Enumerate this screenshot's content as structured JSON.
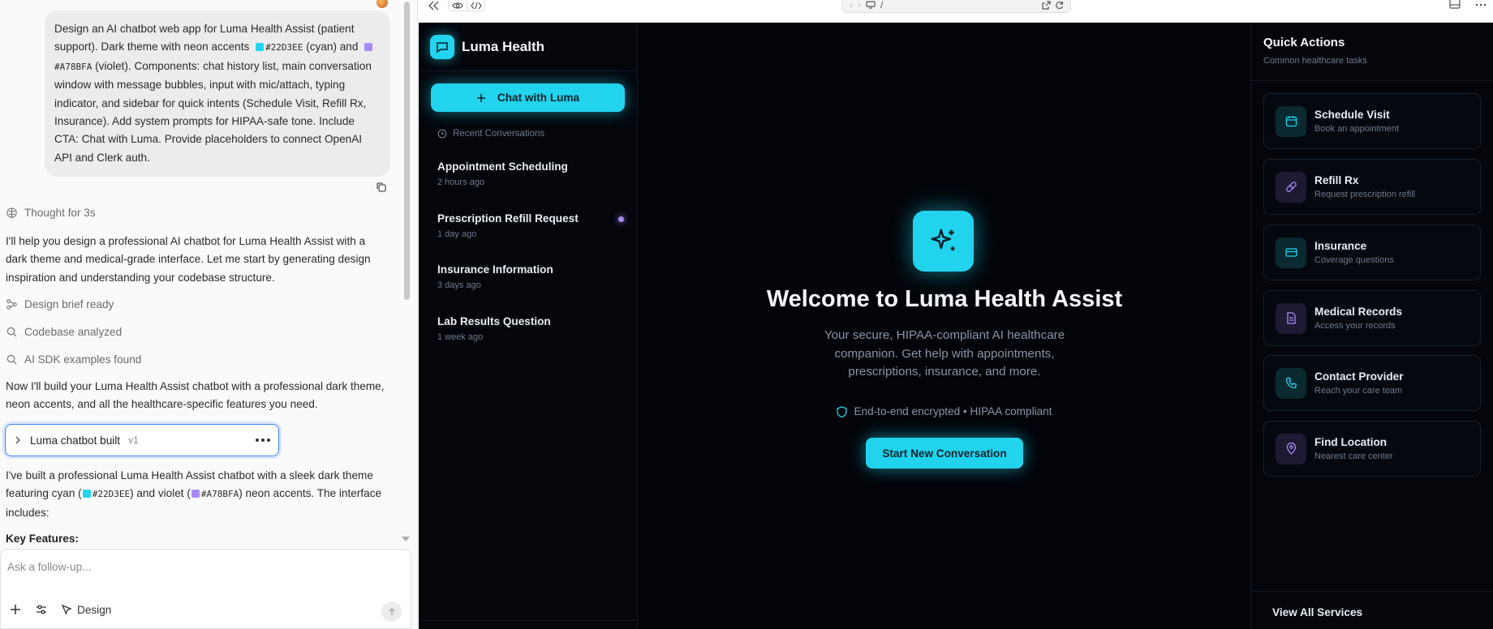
{
  "chat": {
    "user_message": {
      "part1": "Design an AI chatbot web app for Luma Health Assist (patient support). Dark theme with neon accents",
      "hex1": "#22D3EE",
      "part2": "(cyan) and",
      "hex2": "#A78BFA",
      "part3": "(violet). Components: chat history list, main conversation window with message bubbles, input with mic/attach, typing indicator, and sidebar for quick intents (Schedule Visit, Refill Rx, Insurance). Add system prompts for HIPAA-safe tone. Include CTA: Chat with Luma. Provide placeholders to connect OpenAI API and Clerk auth."
    },
    "thought_label": "Thought for 3s",
    "intro": "I'll help you design a professional AI chatbot for Luma Health Assist with a dark theme and medical-grade interface. Let me start by generating design inspiration and understanding your codebase structure.",
    "steps": [
      {
        "label": "Design brief ready",
        "icon": "nodes-icon"
      },
      {
        "label": "Codebase analyzed",
        "icon": "search-icon"
      },
      {
        "label": "AI SDK examples found",
        "icon": "search-icon"
      }
    ],
    "build_intro": "Now I'll build your Luma Health Assist chatbot with a professional dark theme, neon accents, and all the healthcare-specific features you need.",
    "artifact": {
      "label": "Luma chatbot built",
      "version": "v1"
    },
    "summary": {
      "part1": "I've built a professional Luma Health Assist chatbot with a sleek dark theme featuring cyan (",
      "hex1": "#22D3EE",
      "part2": ") and violet (",
      "hex2": "#A78BFA",
      "part3": ") neon accents. The interface includes:"
    },
    "key_features": "Key Features:",
    "composer": {
      "placeholder": "Ask a follow-up...",
      "design_label": "Design"
    }
  },
  "browser": {
    "url": "/"
  },
  "app": {
    "brand": "Luma Health",
    "cta_label": "Chat with Luma",
    "recent_label": "Recent Conversations",
    "conversations": [
      {
        "title": "Appointment Scheduling",
        "time": "2 hours ago"
      },
      {
        "title": "Prescription Refill Request",
        "time": "1 day ago"
      },
      {
        "title": "Insurance Information",
        "time": "3 days ago"
      },
      {
        "title": "Lab Results Question",
        "time": "1 week ago"
      }
    ],
    "welcome_title": "Welcome to Luma Health Assist",
    "welcome_sub": "Your secure, HIPAA-compliant AI healthcare companion. Get help with appointments, prescriptions, insurance, and more.",
    "secure_note": "End-to-end encrypted • HIPAA compliant",
    "start_label": "Start New Conversation",
    "quick_actions": {
      "title": "Quick Actions",
      "subtitle": "Common healthcare tasks",
      "items": [
        {
          "title": "Schedule Visit",
          "desc": "Book an appointment",
          "icon": "calendar-icon"
        },
        {
          "title": "Refill Rx",
          "desc": "Request prescription refill",
          "icon": "pill-icon"
        },
        {
          "title": "Insurance",
          "desc": "Coverage questions",
          "icon": "card-icon"
        },
        {
          "title": "Medical Records",
          "desc": "Access your records",
          "icon": "document-icon"
        },
        {
          "title": "Contact Provider",
          "desc": "Reach your care team",
          "icon": "phone-icon"
        },
        {
          "title": "Find Location",
          "desc": "Nearest care center",
          "icon": "map-pin-icon"
        }
      ],
      "view_all": "View All Services"
    }
  },
  "colors": {
    "cyan": "#22D3EE",
    "violet": "#A78BFA",
    "bg": "#020409"
  }
}
